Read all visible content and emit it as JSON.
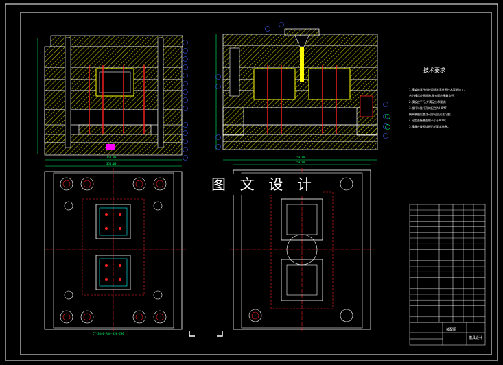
{
  "watermark": "图 文 设 计",
  "technical_requirements": {
    "title": "技术要求",
    "notes": [
      "1.模架的零件应按照标准零件图技术要求加工,",
      "合上模后应无间隙,配合面应接触良好;",
      "2.模板应平行,并满足技术要求;",
      "3.推杆与推杆孔的配合为H8/f7;",
      "模具装配后各活动部分应灵活可靠;",
      "4.分型面接触面积不小于80%;",
      "5.模具应按照试模后的要求修整。"
    ]
  },
  "dimension_labels": {
    "left_top_width": "350.00",
    "right_top_width": "350.00",
    "left_plan_width": "350.00",
    "right_plan_width": "350.00",
    "bottom_left_note": "CT-3040-A30-B50-C90"
  },
  "title_block": {
    "drawing_name": "装配图",
    "designer": "模具设计"
  },
  "colors": {
    "background": "#000000",
    "outline": "#ffffff",
    "hatch": "#c8c800",
    "part_red": "#ff2020",
    "dimension_green": "#00ff66",
    "balloon_blue": "#4060ff",
    "magenta": "#ff00ff",
    "cyan": "#00ffff"
  }
}
